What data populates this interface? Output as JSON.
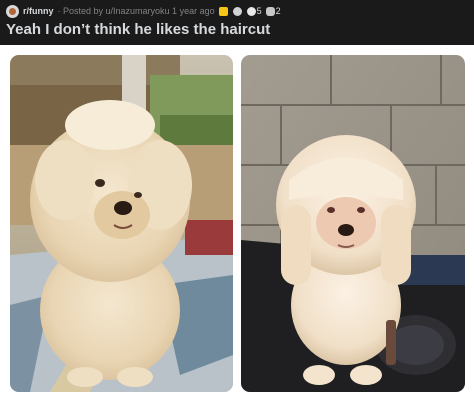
{
  "post": {
    "subreddit": "r/funny",
    "byline": "· Posted by u/Inazumaryoku 1 year ago",
    "awards": [
      {
        "icon": "gold-award-icon",
        "count": ""
      },
      {
        "icon": "silver-award-icon",
        "count": ""
      },
      {
        "icon": "helpful-award-icon",
        "count": "5"
      },
      {
        "icon": "wholesome-award-icon",
        "count": "2"
      }
    ],
    "title": "Yeah I don’t think he likes the haircut"
  },
  "images": [
    {
      "subject": "fluffy-dog-before-haircut"
    },
    {
      "subject": "dog-after-haircut"
    }
  ],
  "colors": {
    "header_bg": "#1a1a1b",
    "title_text": "#d7dadc",
    "meta_text": "#818384",
    "page_bg": "#ffffff"
  }
}
